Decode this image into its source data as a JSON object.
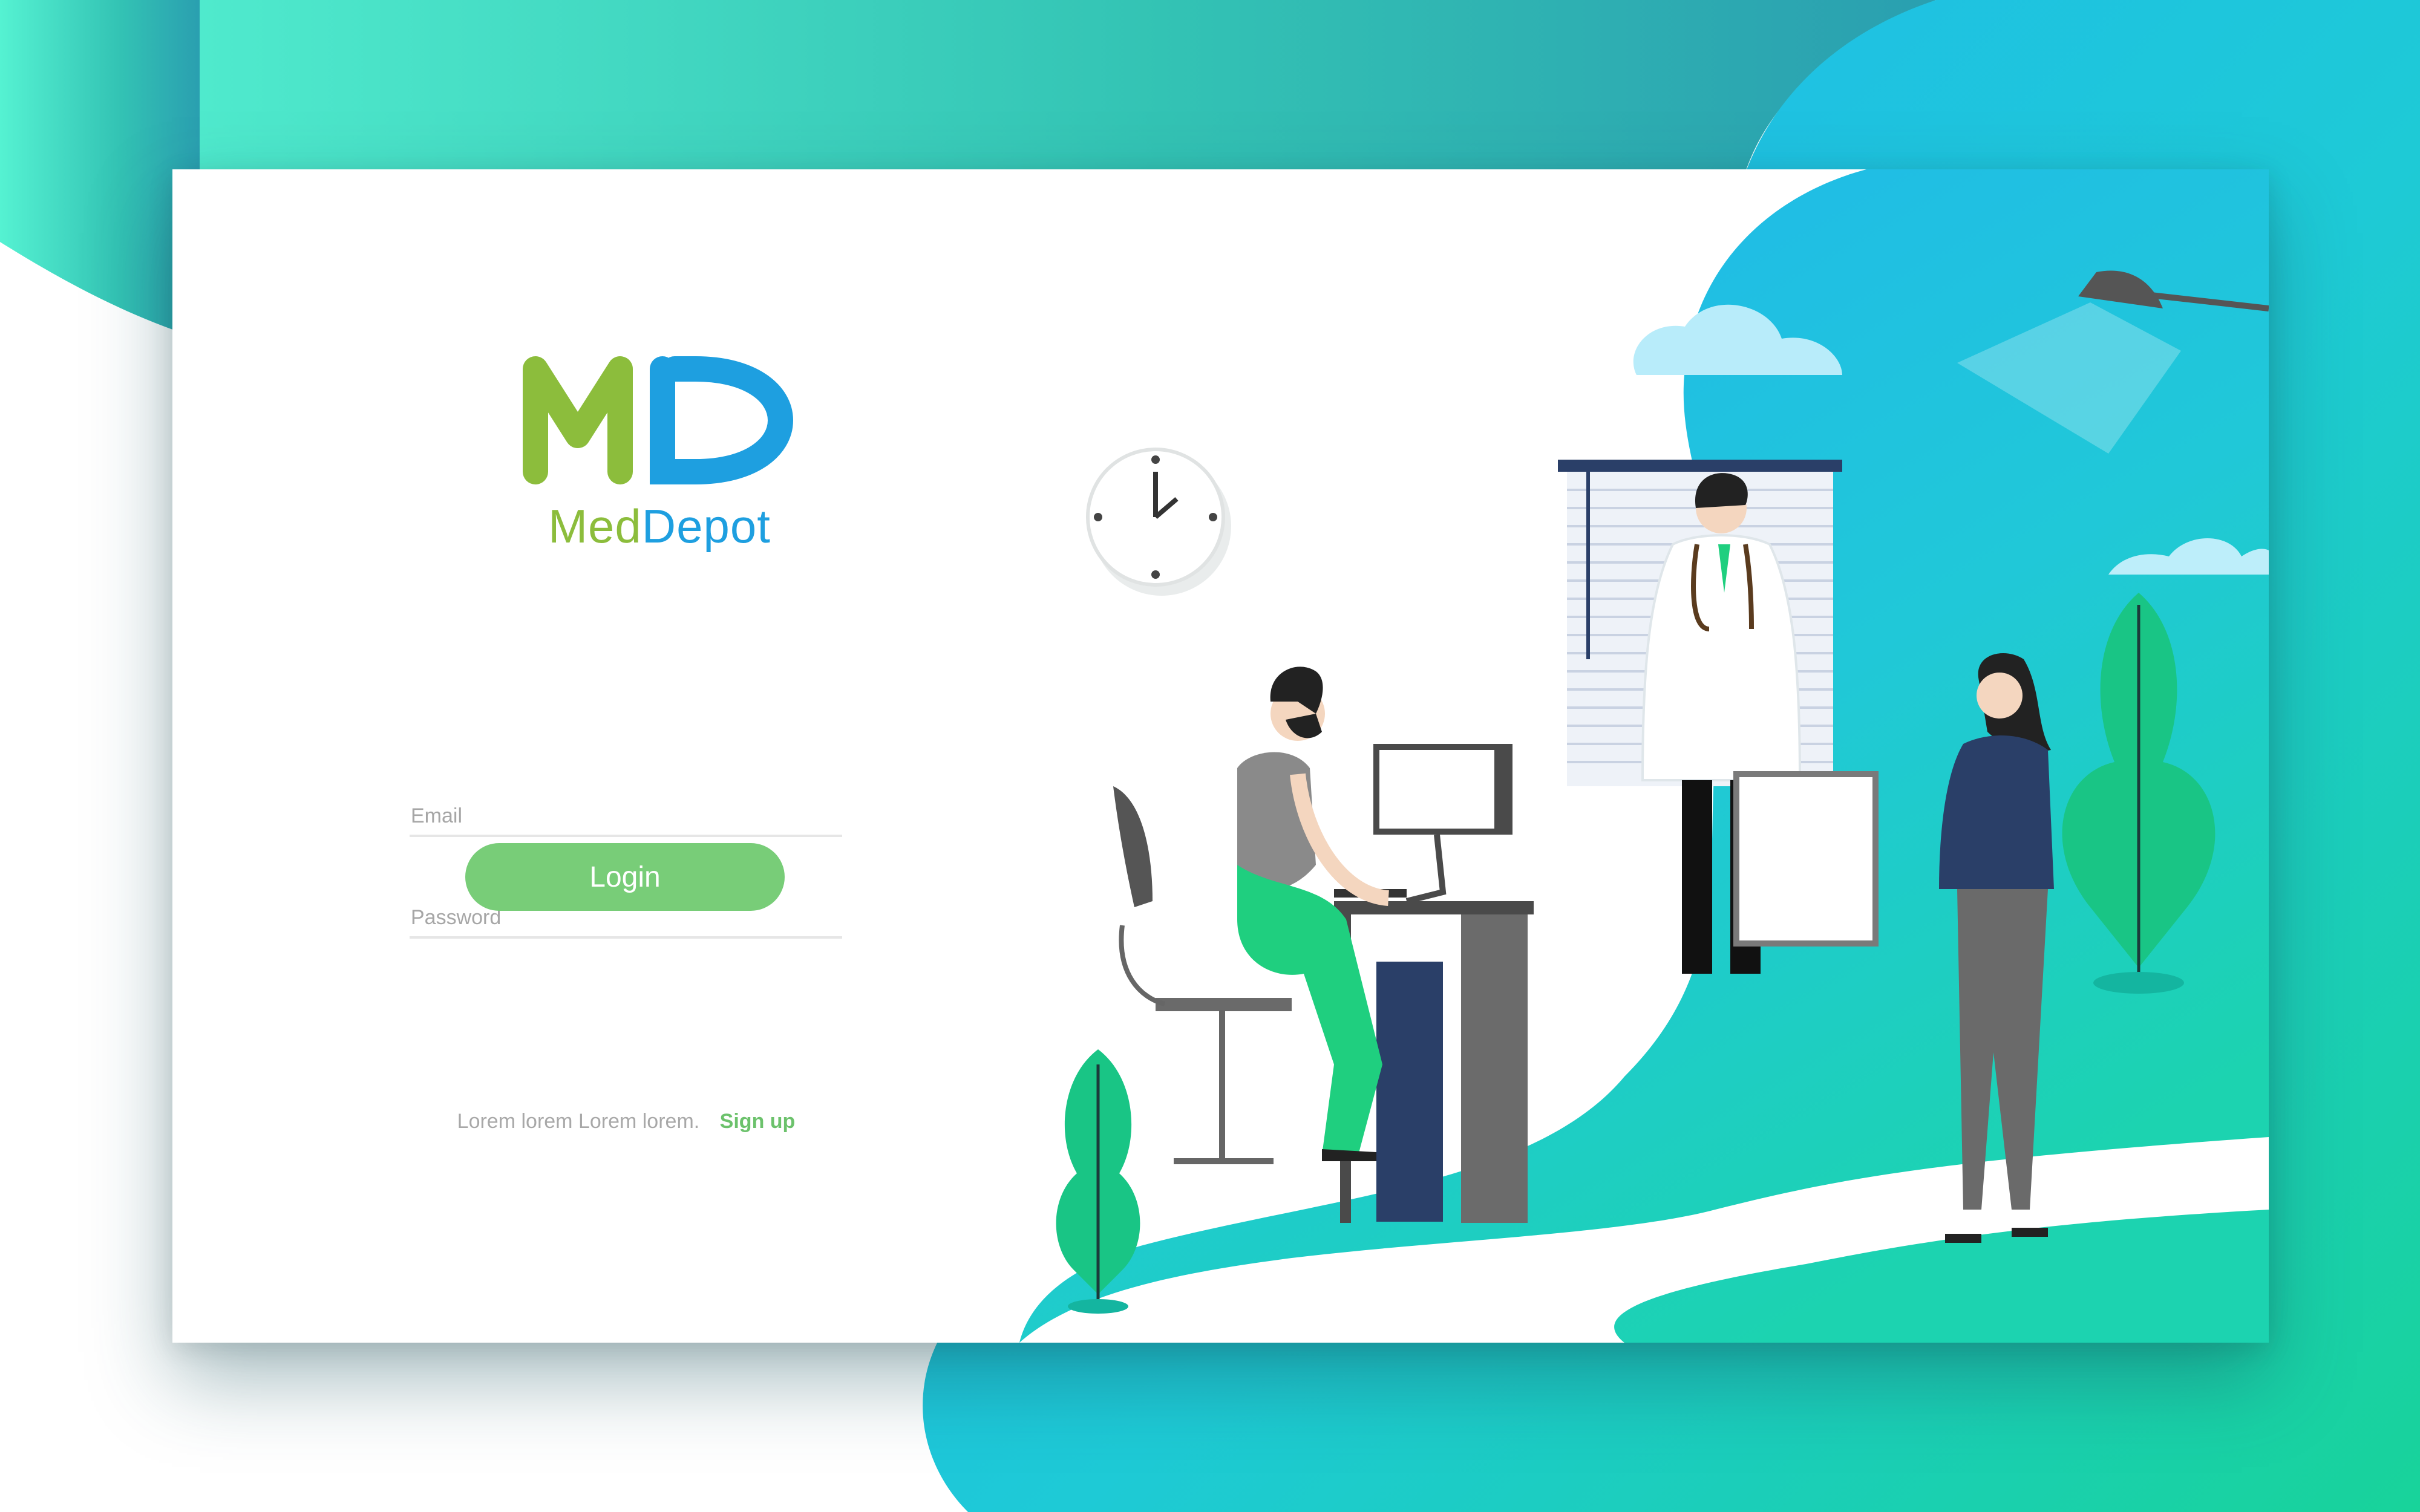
{
  "brand": {
    "name_part1": "Med",
    "name_part2": "Depot",
    "monogram": "MD",
    "colors": {
      "green": "#8cbd3c",
      "blue": "#1e9fe0"
    }
  },
  "login_form": {
    "email_placeholder": "Email",
    "password_placeholder": "Password",
    "login_label": "Login"
  },
  "signup": {
    "prompt_text": "Lorem lorem Lorem lorem.",
    "link_label": "Sign up"
  },
  "theme": {
    "accent_teal": "#3fe3c4",
    "accent_blue": "#1fb8ee",
    "button_green": "#78cd78"
  },
  "illustration": {
    "icons": [
      "wall-clock-icon",
      "window-blinds-icon",
      "desk-lamp-icon",
      "plant-icon",
      "computer-monitor-icon",
      "office-chair-icon",
      "doctor-figure",
      "patient-figure",
      "woman-figure"
    ]
  }
}
